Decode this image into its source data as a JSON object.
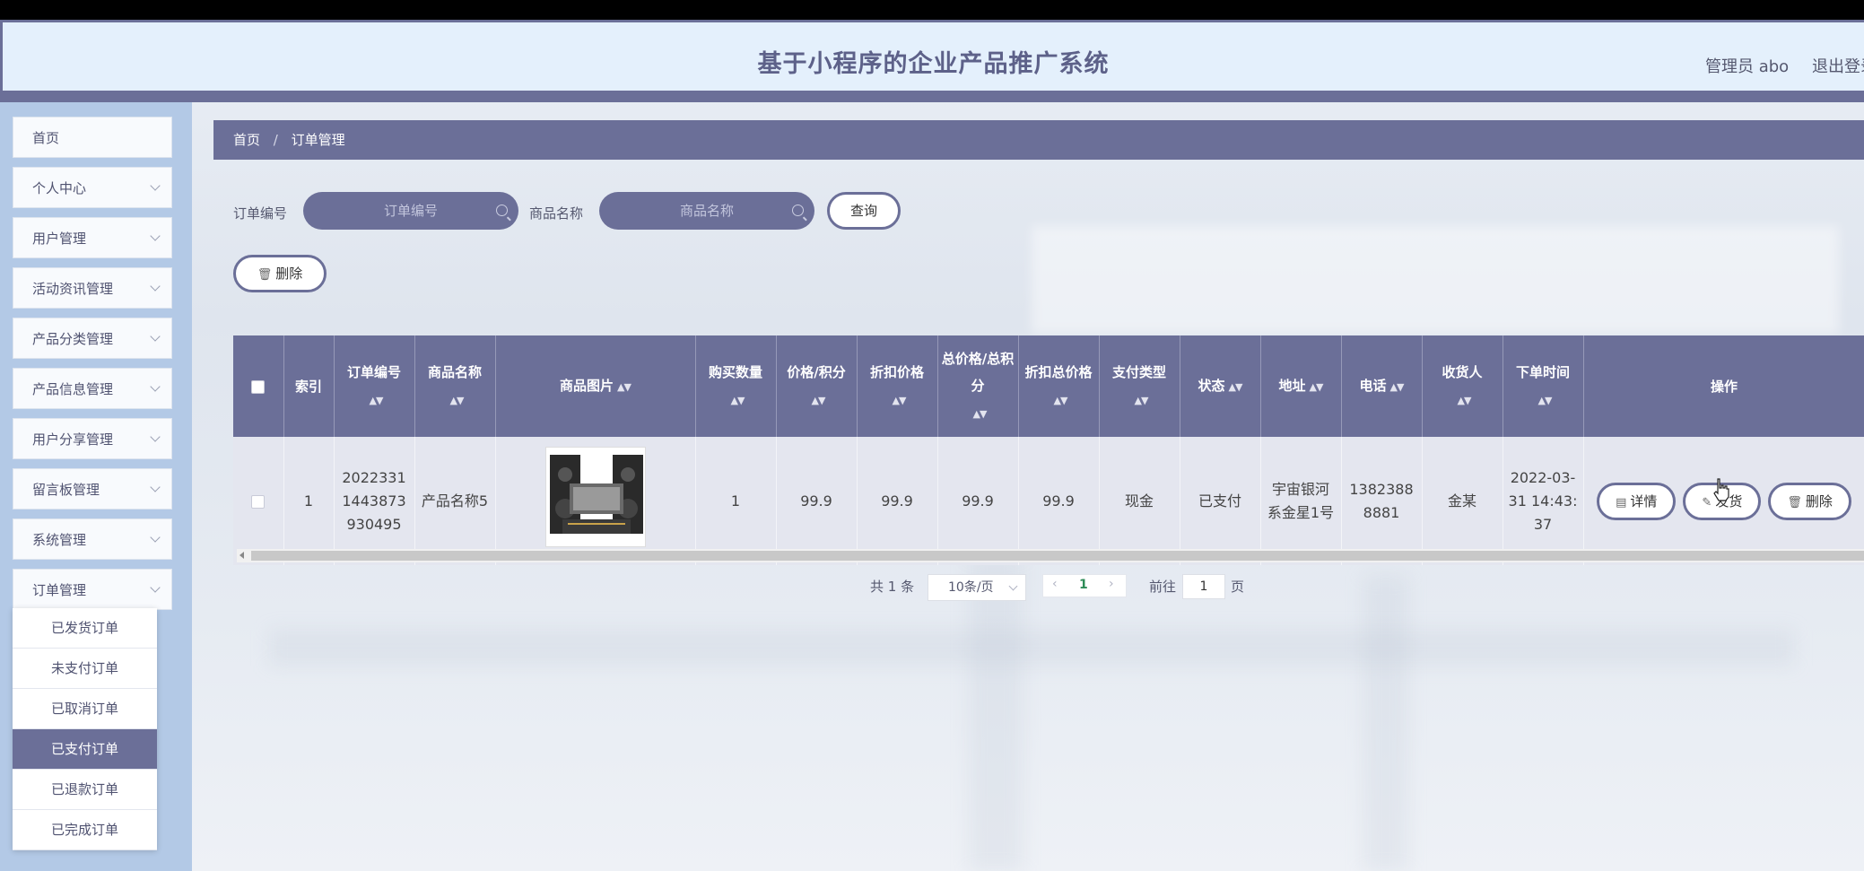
{
  "header": {
    "title": "基于小程序的企业产品推广系统",
    "user": "管理员 abo",
    "logout": "退出登录"
  },
  "sidebar": {
    "items": [
      {
        "label": "首页",
        "has_children": false
      },
      {
        "label": "个人中心",
        "has_children": true
      },
      {
        "label": "用户管理",
        "has_children": true
      },
      {
        "label": "活动资讯管理",
        "has_children": true
      },
      {
        "label": "产品分类管理",
        "has_children": true
      },
      {
        "label": "产品信息管理",
        "has_children": true
      },
      {
        "label": "用户分享管理",
        "has_children": true
      },
      {
        "label": "留言板管理",
        "has_children": true
      },
      {
        "label": "系统管理",
        "has_children": true
      },
      {
        "label": "订单管理",
        "has_children": true
      }
    ],
    "submenu": [
      {
        "label": "已发货订单"
      },
      {
        "label": "未支付订单"
      },
      {
        "label": "已取消订单"
      },
      {
        "label": "已支付订单",
        "active": true
      },
      {
        "label": "已退款订单"
      },
      {
        "label": "已完成订单"
      }
    ]
  },
  "breadcrumb": {
    "home": "首页",
    "separator": "/",
    "current": "订单管理"
  },
  "search": {
    "order_no_label": "订单编号",
    "order_no_placeholder": "订单编号",
    "product_name_label": "商品名称",
    "product_name_placeholder": "商品名称",
    "query_button": "查询"
  },
  "toolbar": {
    "delete_button": "删除"
  },
  "table": {
    "columns": [
      {
        "label": "",
        "sortable": false
      },
      {
        "label": "索引",
        "sortable": false
      },
      {
        "label": "订单编号",
        "sortable": true
      },
      {
        "label": "商品名称",
        "sortable": true
      },
      {
        "label": "商品图片",
        "sortable": true
      },
      {
        "label": "购买数量",
        "sortable": true
      },
      {
        "label": "价格/积分",
        "sortable": true
      },
      {
        "label": "折扣价格",
        "sortable": true
      },
      {
        "label": "总价格/总积分",
        "sortable": true
      },
      {
        "label": "折扣总价格",
        "sortable": true
      },
      {
        "label": "支付类型",
        "sortable": true
      },
      {
        "label": "状态",
        "sortable": true
      },
      {
        "label": "地址",
        "sortable": true
      },
      {
        "label": "电话",
        "sortable": true
      },
      {
        "label": "收货人",
        "sortable": true
      },
      {
        "label": "下单时间",
        "sortable": true
      },
      {
        "label": "操作",
        "sortable": false
      }
    ],
    "rows": [
      {
        "index": "1",
        "order_no": "20223311443873930495",
        "product_name": "产品名称5",
        "quantity": "1",
        "price": "99.9",
        "discount_price": "99.9",
        "total_price": "99.9",
        "discount_total": "99.9",
        "pay_type": "现金",
        "status": "已支付",
        "address": "宇宙银河系金星1号",
        "phone": "13823888881",
        "receiver": "金某",
        "order_time": "2022-03-31 14:43:37",
        "actions": {
          "detail": "详情",
          "ship": "发货",
          "delete": "删除"
        }
      }
    ]
  },
  "pagination": {
    "total": "共 1 条",
    "page_size": "10条/页",
    "current_page": "1",
    "goto_label": "前往",
    "goto_value": "1",
    "page_suffix": "页"
  },
  "colors": {
    "accent": "#6b6f98",
    "sidebar_bg": "#b3c9e6",
    "header_bg": "#e4f0fc"
  }
}
